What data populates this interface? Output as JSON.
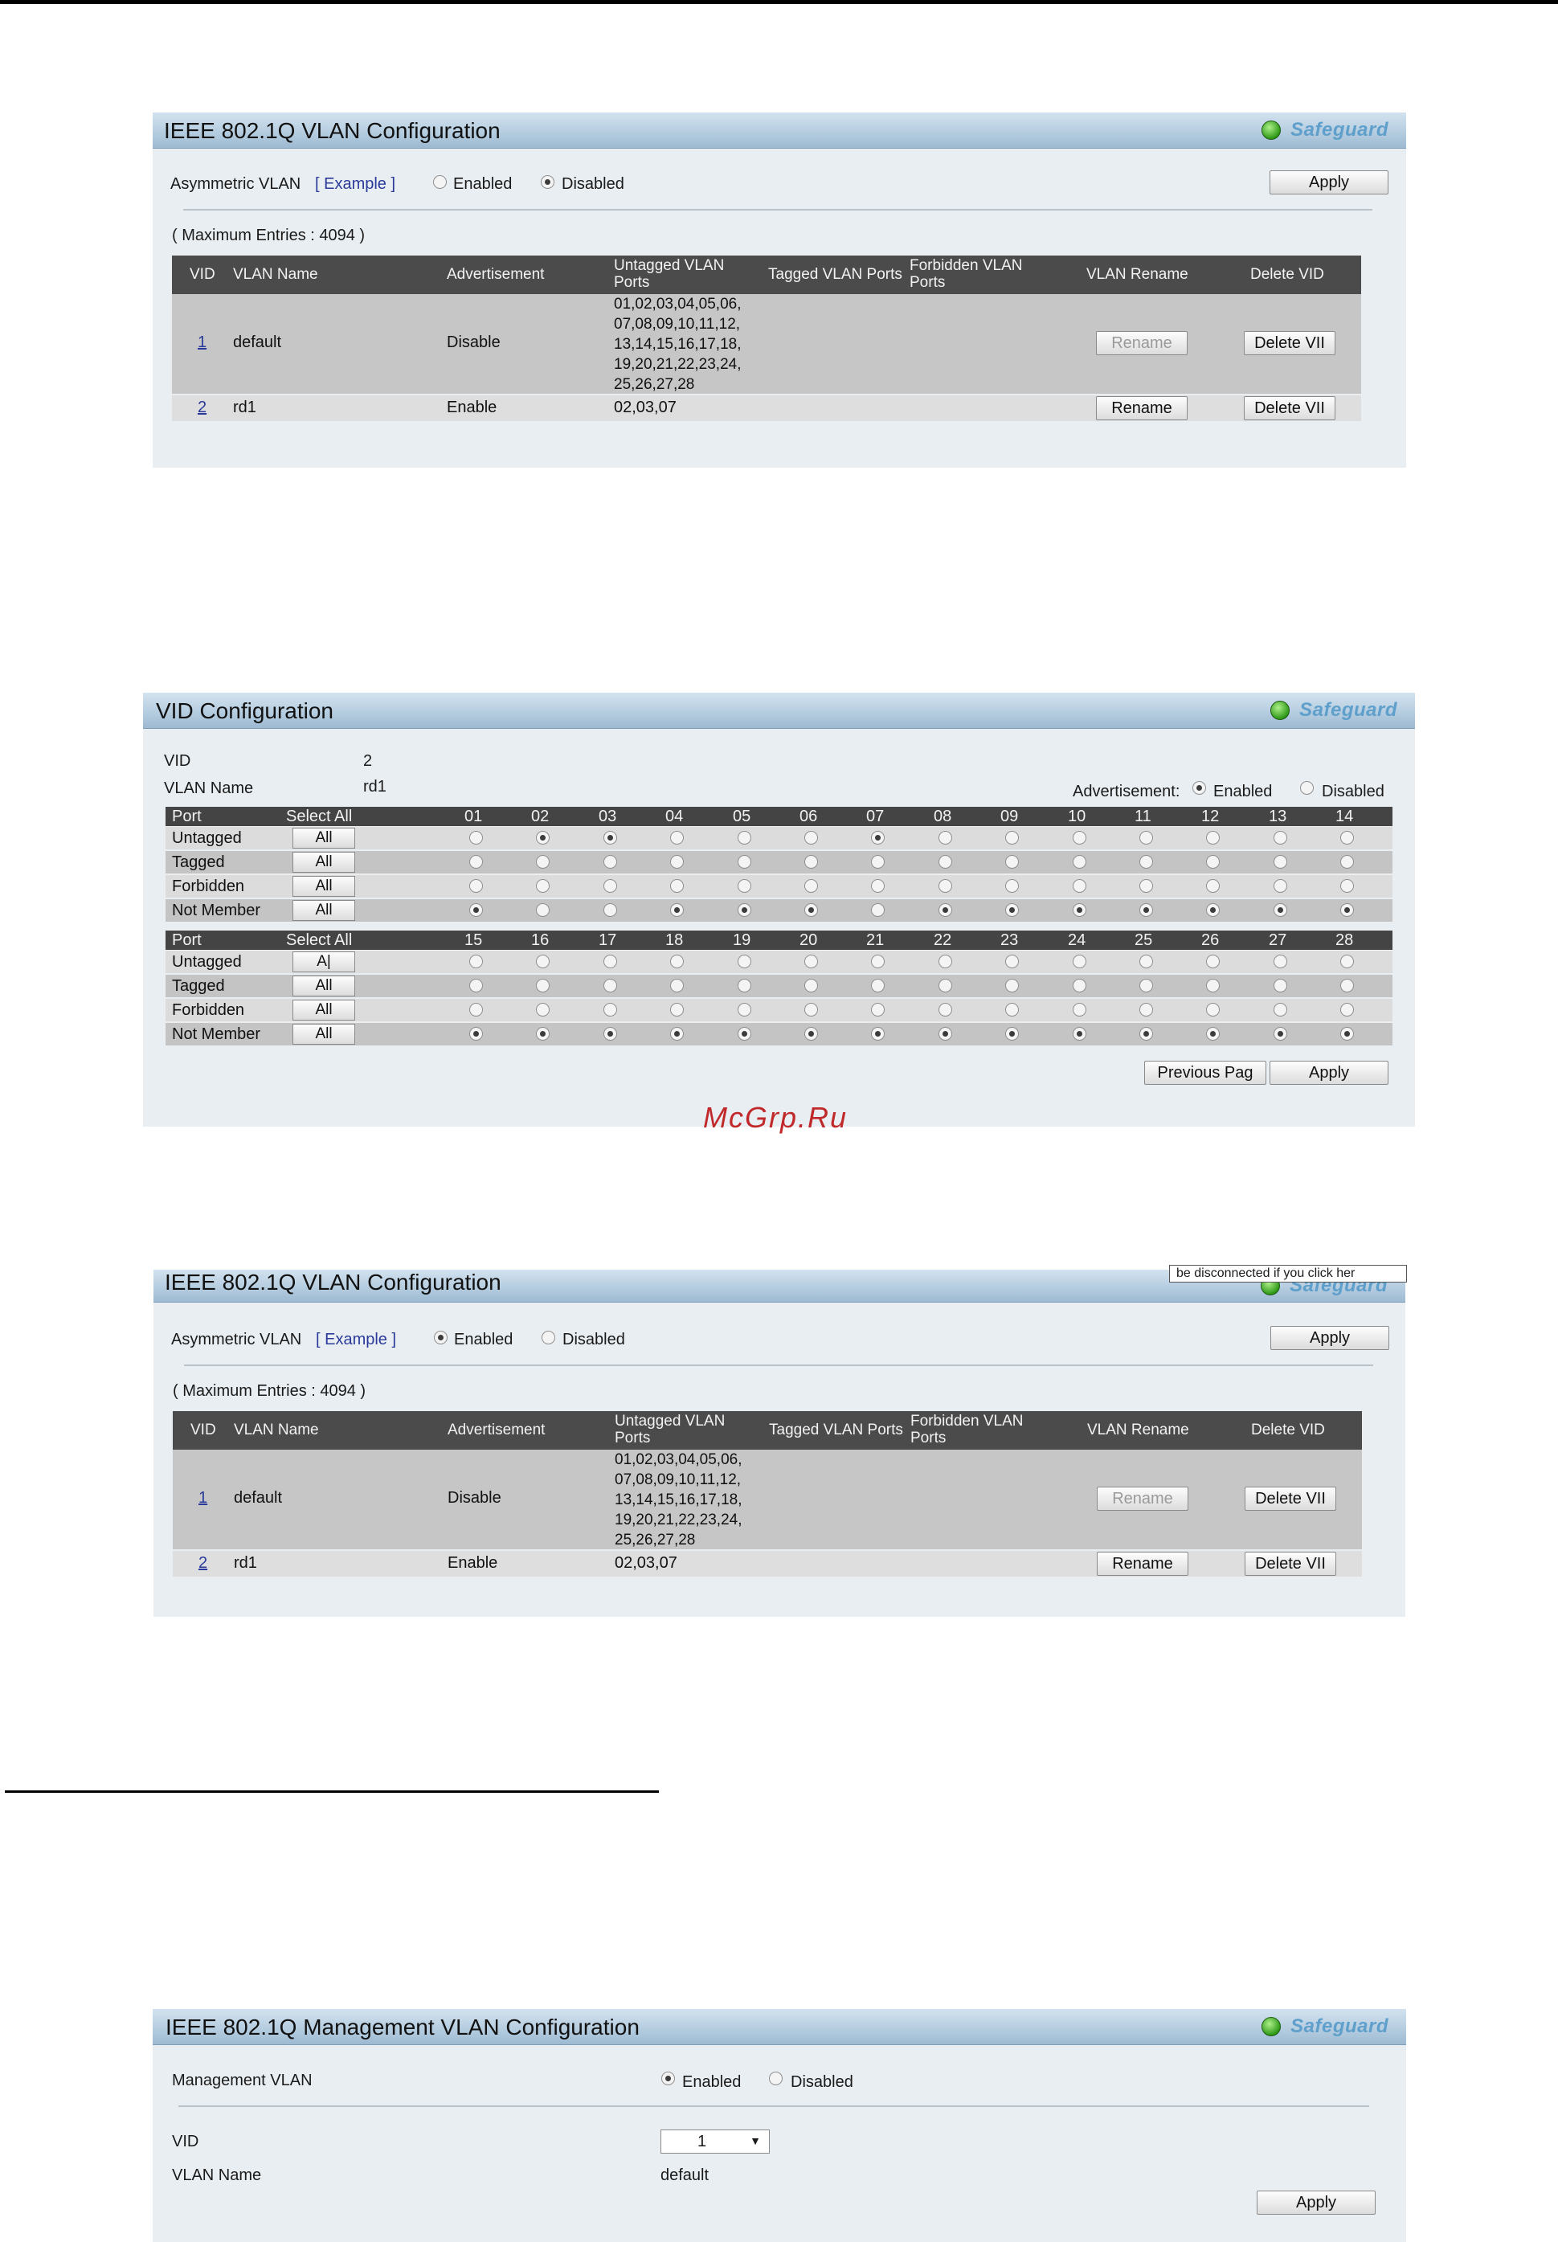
{
  "panel1": {
    "title": "IEEE 802.1Q VLAN Configuration",
    "safeguard": "Safeguard",
    "asym_label": "Asymmetric VLAN",
    "example_link": "[ Example ]",
    "opt_enabled": "Enabled",
    "opt_disabled": "Disabled",
    "selected": "Disabled",
    "apply": "Apply",
    "max_entries": "( Maximum Entries : 4094 )",
    "headers": [
      "VID",
      "VLAN Name",
      "Advertisement",
      "Untagged VLAN\nPorts",
      "Tagged VLAN Ports",
      "Forbidden VLAN\nPorts",
      "VLAN Rename",
      "Delete VID"
    ],
    "rows": [
      {
        "vid": "1",
        "name": "default",
        "adv": "Disable",
        "untagged": "01,02,03,04,05,06,\n07,08,09,10,11,12,\n13,14,15,16,17,18,\n19,20,21,22,23,24,\n25,26,27,28",
        "rename": "Rename",
        "delete": "Delete VII"
      },
      {
        "vid": "2",
        "name": "rd1",
        "adv": "Enable",
        "untagged": "02,03,07",
        "rename": "Rename",
        "delete": "Delete VII"
      }
    ]
  },
  "panel2": {
    "title": "VID Configuration",
    "safeguard": "Safeguard",
    "vid_label": "VID",
    "vid_value": "2",
    "name_label": "VLAN Name",
    "name_value": "rd1",
    "adv_label": "Advertisement:",
    "opt_enabled": "Enabled",
    "opt_disabled": "Disabled",
    "adv_selected": "Enabled",
    "port_header": "Port",
    "select_all_header": "Select All",
    "row_labels": [
      "Untagged",
      "Tagged",
      "Forbidden",
      "Not Member"
    ],
    "all_label": "All",
    "all_label_alt": "A|",
    "group1_ports": [
      "01",
      "02",
      "03",
      "04",
      "05",
      "06",
      "07",
      "08",
      "09",
      "10",
      "11",
      "12",
      "13",
      "14"
    ],
    "group1_state": [
      "N",
      "U",
      "U",
      "N",
      "N",
      "N",
      "U",
      "N",
      "N",
      "N",
      "N",
      "N",
      "N",
      "N"
    ],
    "group2_ports": [
      "15",
      "16",
      "17",
      "18",
      "19",
      "20",
      "21",
      "22",
      "23",
      "24",
      "25",
      "26",
      "27",
      "28"
    ],
    "group2_state": [
      "N",
      "N",
      "N",
      "N",
      "N",
      "N",
      "N",
      "N",
      "N",
      "N",
      "N",
      "N",
      "N",
      "N"
    ],
    "prev_button": "Previous Pag",
    "apply": "Apply"
  },
  "watermark": "McGrp.Ru",
  "panel3": {
    "title": "IEEE 802.1Q VLAN Configuration",
    "tooltip": "be disconnected if you click her",
    "asym_label": "Asymmetric VLAN",
    "example_link": "[ Example ]",
    "opt_enabled": "Enabled",
    "opt_disabled": "Disabled",
    "selected": "Enabled",
    "apply": "Apply",
    "max_entries": "( Maximum Entries : 4094 )",
    "headers": [
      "VID",
      "VLAN Name",
      "Advertisement",
      "Untagged VLAN\nPorts",
      "Tagged VLAN Ports",
      "Forbidden VLAN\nPorts",
      "VLAN Rename",
      "Delete VID"
    ],
    "rows": [
      {
        "vid": "1",
        "name": "default",
        "adv": "Disable",
        "untagged": "01,02,03,04,05,06,\n07,08,09,10,11,12,\n13,14,15,16,17,18,\n19,20,21,22,23,24,\n25,26,27,28",
        "rename": "Rename",
        "delete": "Delete VII"
      },
      {
        "vid": "2",
        "name": "rd1",
        "adv": "Enable",
        "untagged": "02,03,07",
        "rename": "Rename",
        "delete": "Delete VII"
      }
    ]
  },
  "panel4": {
    "title": "IEEE 802.1Q Management VLAN Configuration",
    "safeguard": "Safeguard",
    "mgmt_label": "Management VLAN",
    "opt_enabled": "Enabled",
    "opt_disabled": "Disabled",
    "selected": "Enabled",
    "vid_label": "VID",
    "vid_value": "1",
    "name_label": "VLAN Name",
    "name_value": "default",
    "apply": "Apply"
  }
}
